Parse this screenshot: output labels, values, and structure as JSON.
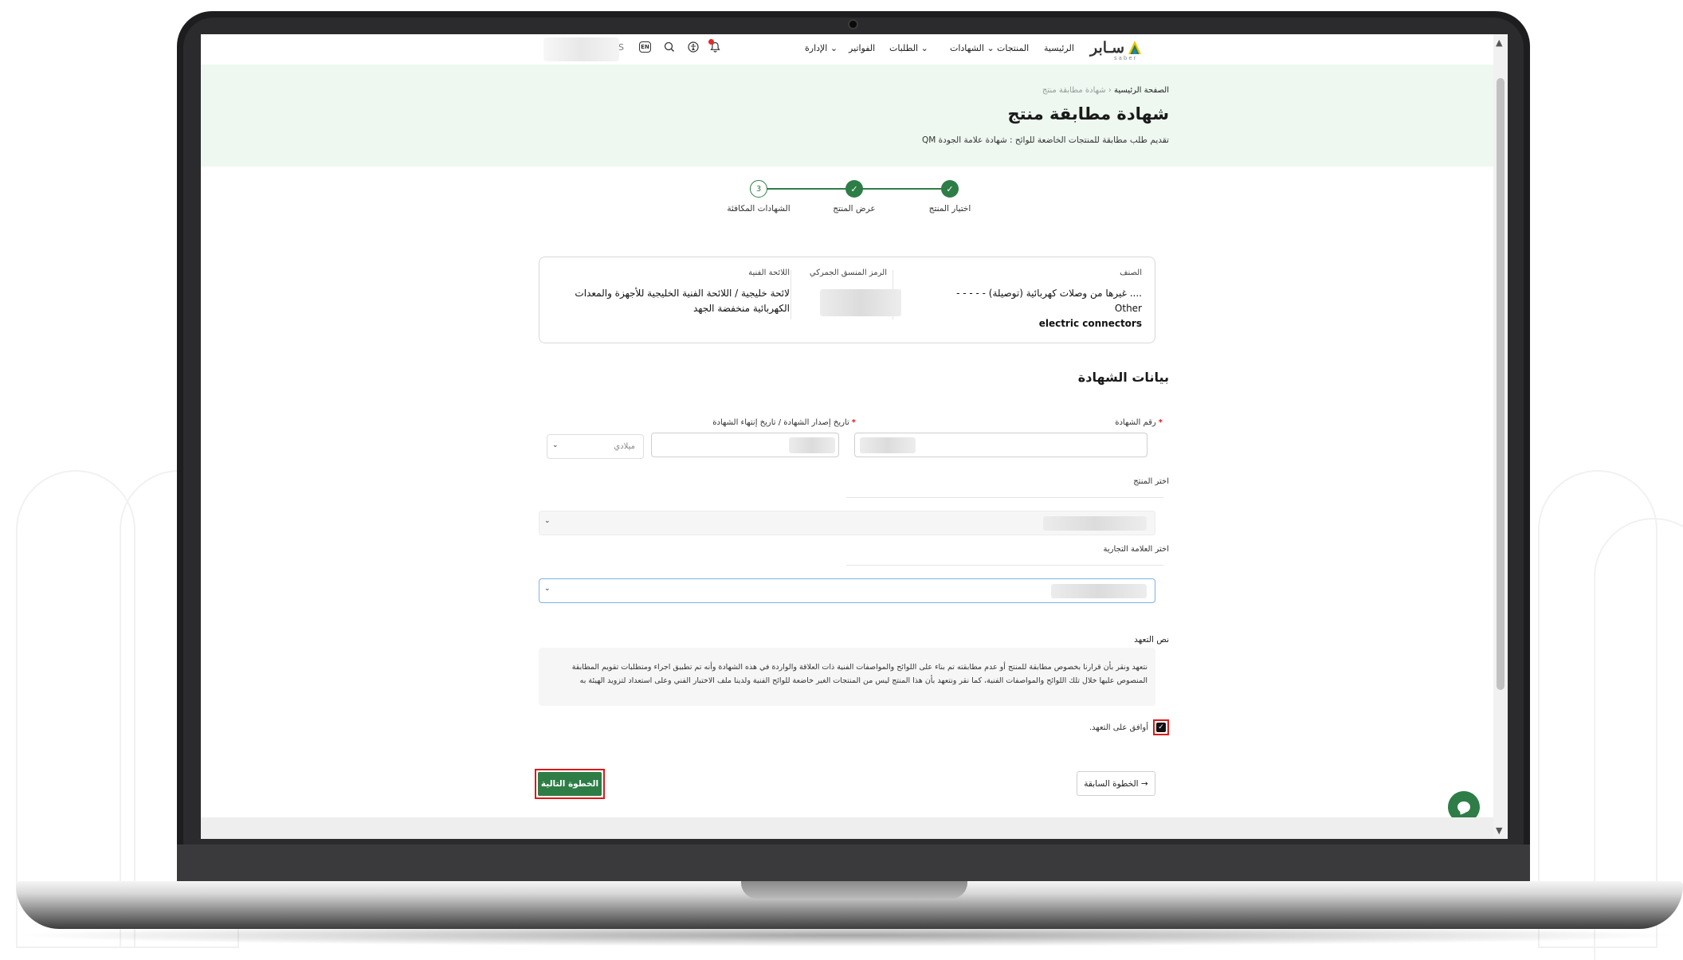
{
  "nav": {
    "logo_text": "سـابر",
    "logo_sub": "saber",
    "items": [
      "الرئيسية",
      "المنتجات",
      "الشهادات",
      "الطلبات",
      "الفواتير",
      "الإدارة"
    ],
    "lang": "EN",
    "user_initial": "S"
  },
  "hero": {
    "breadcrumb_home": "الصفحة الرئيسية",
    "breadcrumb_sep": "‹",
    "breadcrumb_current": "شهادة مطابقة منتج",
    "title": "شهادة مطابقة منتج",
    "subtitle": "تقديم طلب مطابقة للمنتجات الخاضعة للوائح : شهادة علامة الجودة QM"
  },
  "stepper": {
    "steps": [
      "اختيار المنتج",
      "عرض المنتج",
      "الشهادات المكافئة"
    ],
    "current_number": "3",
    "done_mark": "✓"
  },
  "product_card": {
    "category_label": "الصنف",
    "category_value_ar": ".... غيرها من وصلات كهربائية (توصيلة) - - - - - Other",
    "category_value_en": "electric connectors",
    "hs_label": "الرمز المنسق الجمركي",
    "regulation_label": "اللائحة الفنية",
    "regulation_value": "لائحة خليجية / اللائحة الفنية الخليجية للأجهزة والمعدات الكهربائية منخفضة الجهد"
  },
  "certificate": {
    "section_title": "بيانات الشهادة",
    "req_mark": "*",
    "number_label": "رقم الشهادة",
    "date_label": "تاريخ إصدار الشهادة / تاريخ إنتهاء الشهادة",
    "calendar_value": "ميلادي",
    "product_label": "اختر المنتج",
    "brand_label": "اختر العلامة التجارية"
  },
  "pledge": {
    "label": "نص التعهد",
    "text": "نتعهد ونقر بأن قرارنا بخصوص مطابقة للمنتج أو عدم مطابقته تم بناء على اللوائح والمواصفات الفنية ذات العلاقة والواردة في هذه الشهادة وأنه تم تطبيق اجراء ومتطلبات تقويم المطابقة المنصوص عليها خلال تلك اللوائح والمواصفات الفنية، كما نقر ونتعهد بأن هذا المنتج ليس من المنتجات الغير خاضعة للوائح الفنية ولدينا ملف الاختبار الفني وعلى استعداد لتزويد الهيئة به",
    "agree_label": "أوافق على التعهد."
  },
  "actions": {
    "next": "الخطوة التالية",
    "prev": "الخطوة السابقة",
    "prev_arrow": "→"
  },
  "colors": {
    "primary": "#2e7d47",
    "hero_bg": "#eef8f1",
    "highlight": "#e01818"
  }
}
